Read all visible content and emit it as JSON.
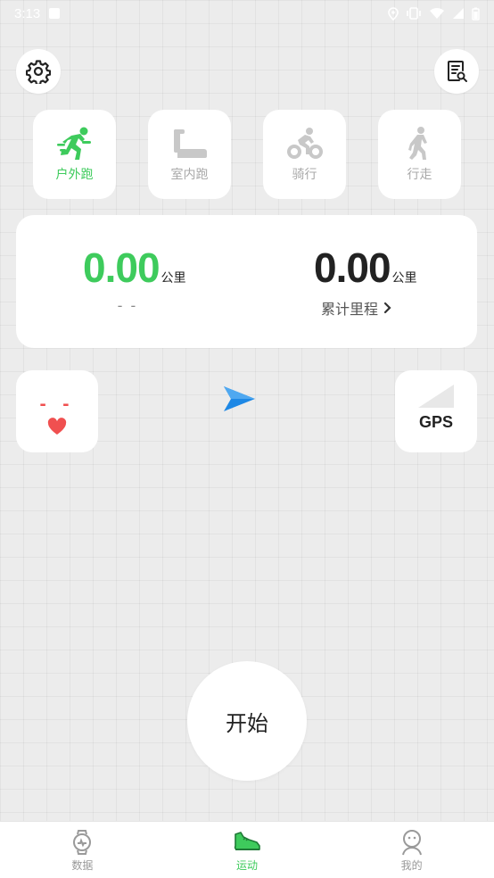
{
  "status_bar": {
    "time": "3:13"
  },
  "top_buttons": {
    "settings_icon": "gear-icon",
    "records_icon": "document-search-icon"
  },
  "modes": [
    {
      "label": "户外跑",
      "icon": "running-icon",
      "active": true
    },
    {
      "label": "室内跑",
      "icon": "treadmill-icon",
      "active": false
    },
    {
      "label": "骑行",
      "icon": "cycling-icon",
      "active": false
    },
    {
      "label": "行走",
      "icon": "walking-icon",
      "active": false
    }
  ],
  "stats": {
    "current": {
      "value": "0.00",
      "unit": "公里",
      "sub": "- -"
    },
    "total": {
      "value": "0.00",
      "unit": "公里",
      "label": "累计里程"
    }
  },
  "heart_rate": {
    "value": "- -",
    "icon": "heart-icon"
  },
  "gps": {
    "label": "GPS",
    "icon": "signal-icon"
  },
  "start_button": {
    "label": "开始"
  },
  "bottom_nav": [
    {
      "label": "数据",
      "icon": "watch-icon",
      "active": false
    },
    {
      "label": "运动",
      "icon": "sneaker-icon",
      "active": true
    },
    {
      "label": "我的",
      "icon": "user-icon",
      "active": false
    }
  ],
  "colors": {
    "accent": "#3ecb5c",
    "heart": "#f05050",
    "arrow": "#1e88e5"
  }
}
